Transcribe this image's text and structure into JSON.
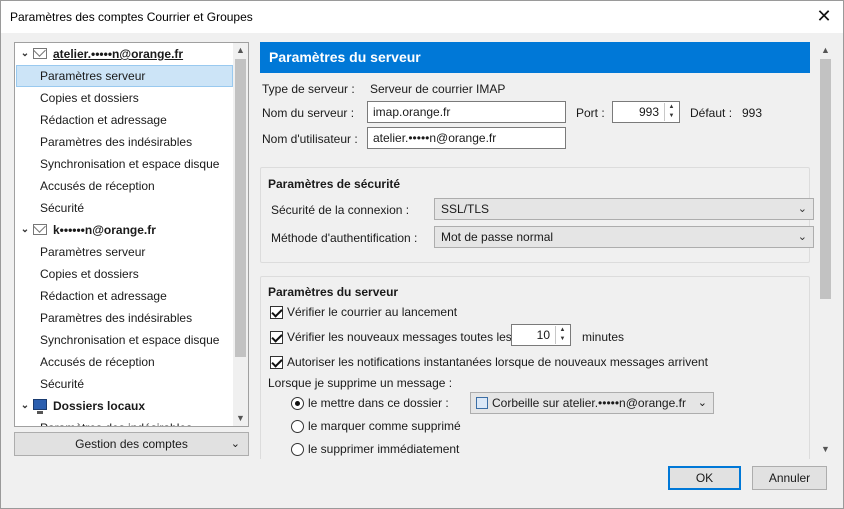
{
  "window": {
    "title": "Paramètres des comptes Courrier et Groupes",
    "close_glyph": "✕",
    "background_fragment": ""
  },
  "tree": {
    "items": [
      {
        "kind": "account",
        "label": "atelier.•••••n@orange.fr",
        "icon": "envelope-icon"
      },
      {
        "kind": "child",
        "label": "Paramètres serveur",
        "selected": true
      },
      {
        "kind": "child",
        "label": "Copies et dossiers"
      },
      {
        "kind": "child",
        "label": "Rédaction et adressage"
      },
      {
        "kind": "child",
        "label": "Paramètres des indésirables"
      },
      {
        "kind": "child",
        "label": "Synchronisation et espace disque"
      },
      {
        "kind": "child",
        "label": "Accusés de réception"
      },
      {
        "kind": "child",
        "label": "Sécurité"
      },
      {
        "kind": "account",
        "label": "k••••••n@orange.fr",
        "icon": "envelope-icon"
      },
      {
        "kind": "child",
        "label": "Paramètres serveur"
      },
      {
        "kind": "child",
        "label": "Copies et dossiers"
      },
      {
        "kind": "child",
        "label": "Rédaction et adressage"
      },
      {
        "kind": "child",
        "label": "Paramètres des indésirables"
      },
      {
        "kind": "child",
        "label": "Synchronisation et espace disque"
      },
      {
        "kind": "child",
        "label": "Accusés de réception"
      },
      {
        "kind": "child",
        "label": "Sécurité"
      },
      {
        "kind": "account",
        "label": "Dossiers locaux",
        "icon": "computer-icon"
      },
      {
        "kind": "child",
        "label": "Paramètres des indésirables"
      }
    ],
    "manage_button": "Gestion des comptes"
  },
  "panel": {
    "header": "Paramètres du serveur",
    "server_type_label": "Type de serveur :",
    "server_type_value": "Serveur de courrier IMAP",
    "server_name_label": "Nom du serveur :",
    "server_name_value": "imap.orange.fr",
    "port_label": "Port :",
    "port_value": "993",
    "default_label": "Défaut :",
    "default_value": "993",
    "username_label": "Nom d'utilisateur :",
    "username_value": "atelier.•••••n@orange.fr",
    "security": {
      "title": "Paramètres de sécurité",
      "connection_label": "Sécurité de la connexion :",
      "connection_value": "SSL/TLS",
      "auth_label": "Méthode d'authentification :",
      "auth_value": "Mot de passe normal"
    },
    "server": {
      "title": "Paramètres du serveur",
      "check_startup": "Vérifier le courrier au lancement",
      "check_every": "Vérifier les nouveaux messages toutes les",
      "check_every_value": "10",
      "minutes": "minutes",
      "push_notifications": "Autoriser les notifications instantanées lorsque de nouveaux messages arrivent",
      "on_delete_label": "Lorsque je supprime un message :",
      "move_to_folder": "le mettre dans ce dossier :",
      "trash_folder": "Corbeille sur atelier.•••••n@orange.fr",
      "mark_deleted": "le marquer comme supprimé",
      "delete_now": "le supprimer immédiatement"
    }
  },
  "buttons": {
    "ok": "OK",
    "cancel": "Annuler"
  },
  "colors": {
    "accent": "#0078d7",
    "selection": "#cce4f7"
  }
}
